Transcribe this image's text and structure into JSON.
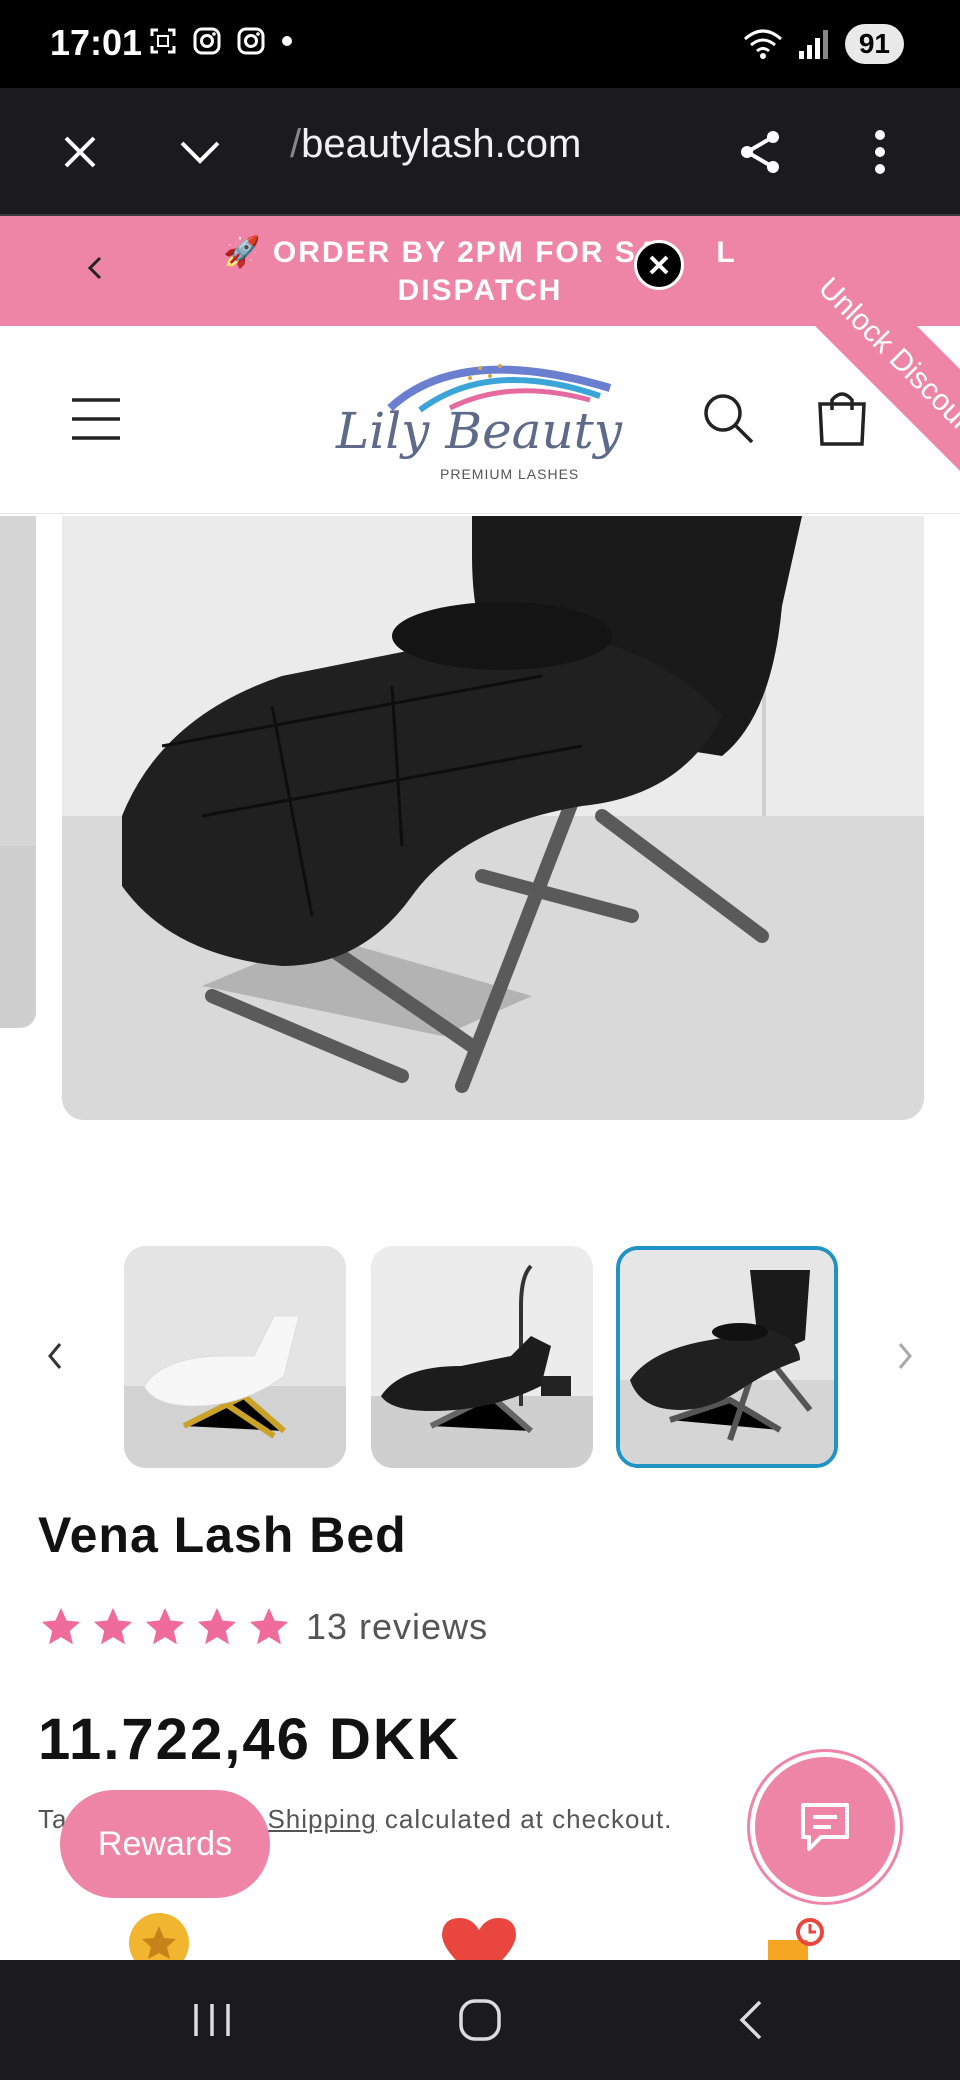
{
  "status_bar": {
    "time": "17:01",
    "battery": "91"
  },
  "browser": {
    "url_prefix": "/",
    "url": "beautylash.com"
  },
  "announcement": {
    "text": "🚀 ORDER BY 2PM FOR SAME DISPATCH",
    "visible_text_line1": "🚀 ORDER BY 2PM FOR SA",
    "visible_text_line1_end": "L",
    "visible_text_line2": "DISPATCH",
    "ribbon_label": "Unlock Discount"
  },
  "header": {
    "logo_script": "Lily Beauty",
    "logo_sub": "PREMIUM LASHES"
  },
  "product": {
    "title": "Vena Lash Bed",
    "rating_text": "13 reviews",
    "stars": 5,
    "price": "11.722,46 DKK",
    "tax_prefix": "Ta",
    "tax_link": "Shipping",
    "tax_suffix": " calculated at checkout."
  },
  "widgets": {
    "rewards_label": "Rewards"
  },
  "colors": {
    "accent_pink": "#ee85a7",
    "thumb_active": "#1f93c4",
    "star": "#ee6b9a"
  }
}
